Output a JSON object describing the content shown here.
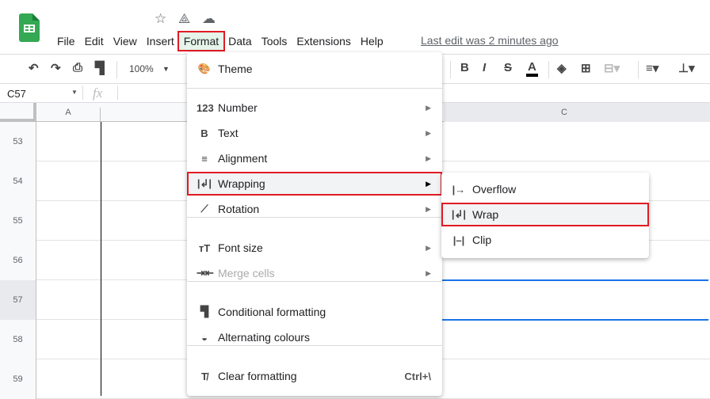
{
  "menubar": {
    "items": [
      "File",
      "Edit",
      "View",
      "Insert",
      "Format",
      "Data",
      "Tools",
      "Extensions",
      "Help"
    ],
    "active": "Format",
    "last_edit": "Last edit was 2 minutes ago"
  },
  "toolbar": {
    "zoom": "100%",
    "bold": "B",
    "italic": "I",
    "strike": "S",
    "text_color": "A",
    "text_color_value": "#000000"
  },
  "formula": {
    "cell_ref": "C57",
    "fx": "fx"
  },
  "columns": [
    "A",
    "C"
  ],
  "rows": [
    "53",
    "54",
    "55",
    "56",
    "57",
    "58",
    "59"
  ],
  "selected_row": "57",
  "format_menu": {
    "items": [
      {
        "icon": "palette-icon",
        "glyph": "🎨",
        "label": "Theme"
      },
      {
        "icon": "number-icon",
        "glyph": "123",
        "label": "Number",
        "arrow": true
      },
      {
        "icon": "bold-icon",
        "glyph": "B",
        "label": "Text",
        "arrow": true
      },
      {
        "icon": "align-icon",
        "glyph": "≡",
        "label": "Alignment",
        "arrow": true
      },
      {
        "icon": "wrap-icon",
        "glyph": "|↲|",
        "label": "Wrapping",
        "arrow": true,
        "highlighted": true
      },
      {
        "icon": "rotation-icon",
        "glyph": "⟋",
        "label": "Rotation",
        "arrow": true
      },
      {
        "icon": "font-size-icon",
        "glyph": "тT",
        "label": "Font size",
        "arrow": true
      },
      {
        "icon": "merge-icon",
        "glyph": "⇥⇤",
        "label": "Merge cells",
        "arrow": true,
        "disabled": true
      },
      {
        "icon": "paint-roller-icon",
        "glyph": "▜",
        "label": "Conditional formatting"
      },
      {
        "icon": "drop-icon",
        "glyph": "◒",
        "label": "Alternating colours"
      },
      {
        "icon": "clear-format-icon",
        "glyph": "T̸",
        "label": "Clear formatting",
        "shortcut": "Ctrl+\\"
      }
    ]
  },
  "wrapping_submenu": {
    "items": [
      {
        "icon": "overflow-icon",
        "glyph": "|→",
        "label": "Overflow"
      },
      {
        "icon": "wrap-icon",
        "glyph": "|↲|",
        "label": "Wrap",
        "highlighted": true
      },
      {
        "icon": "clip-icon",
        "glyph": "|–|",
        "label": "Clip"
      }
    ]
  },
  "colors": {
    "highlight_border": "#e01b24",
    "selection": "#1a73e8",
    "logo": "#34a853"
  }
}
